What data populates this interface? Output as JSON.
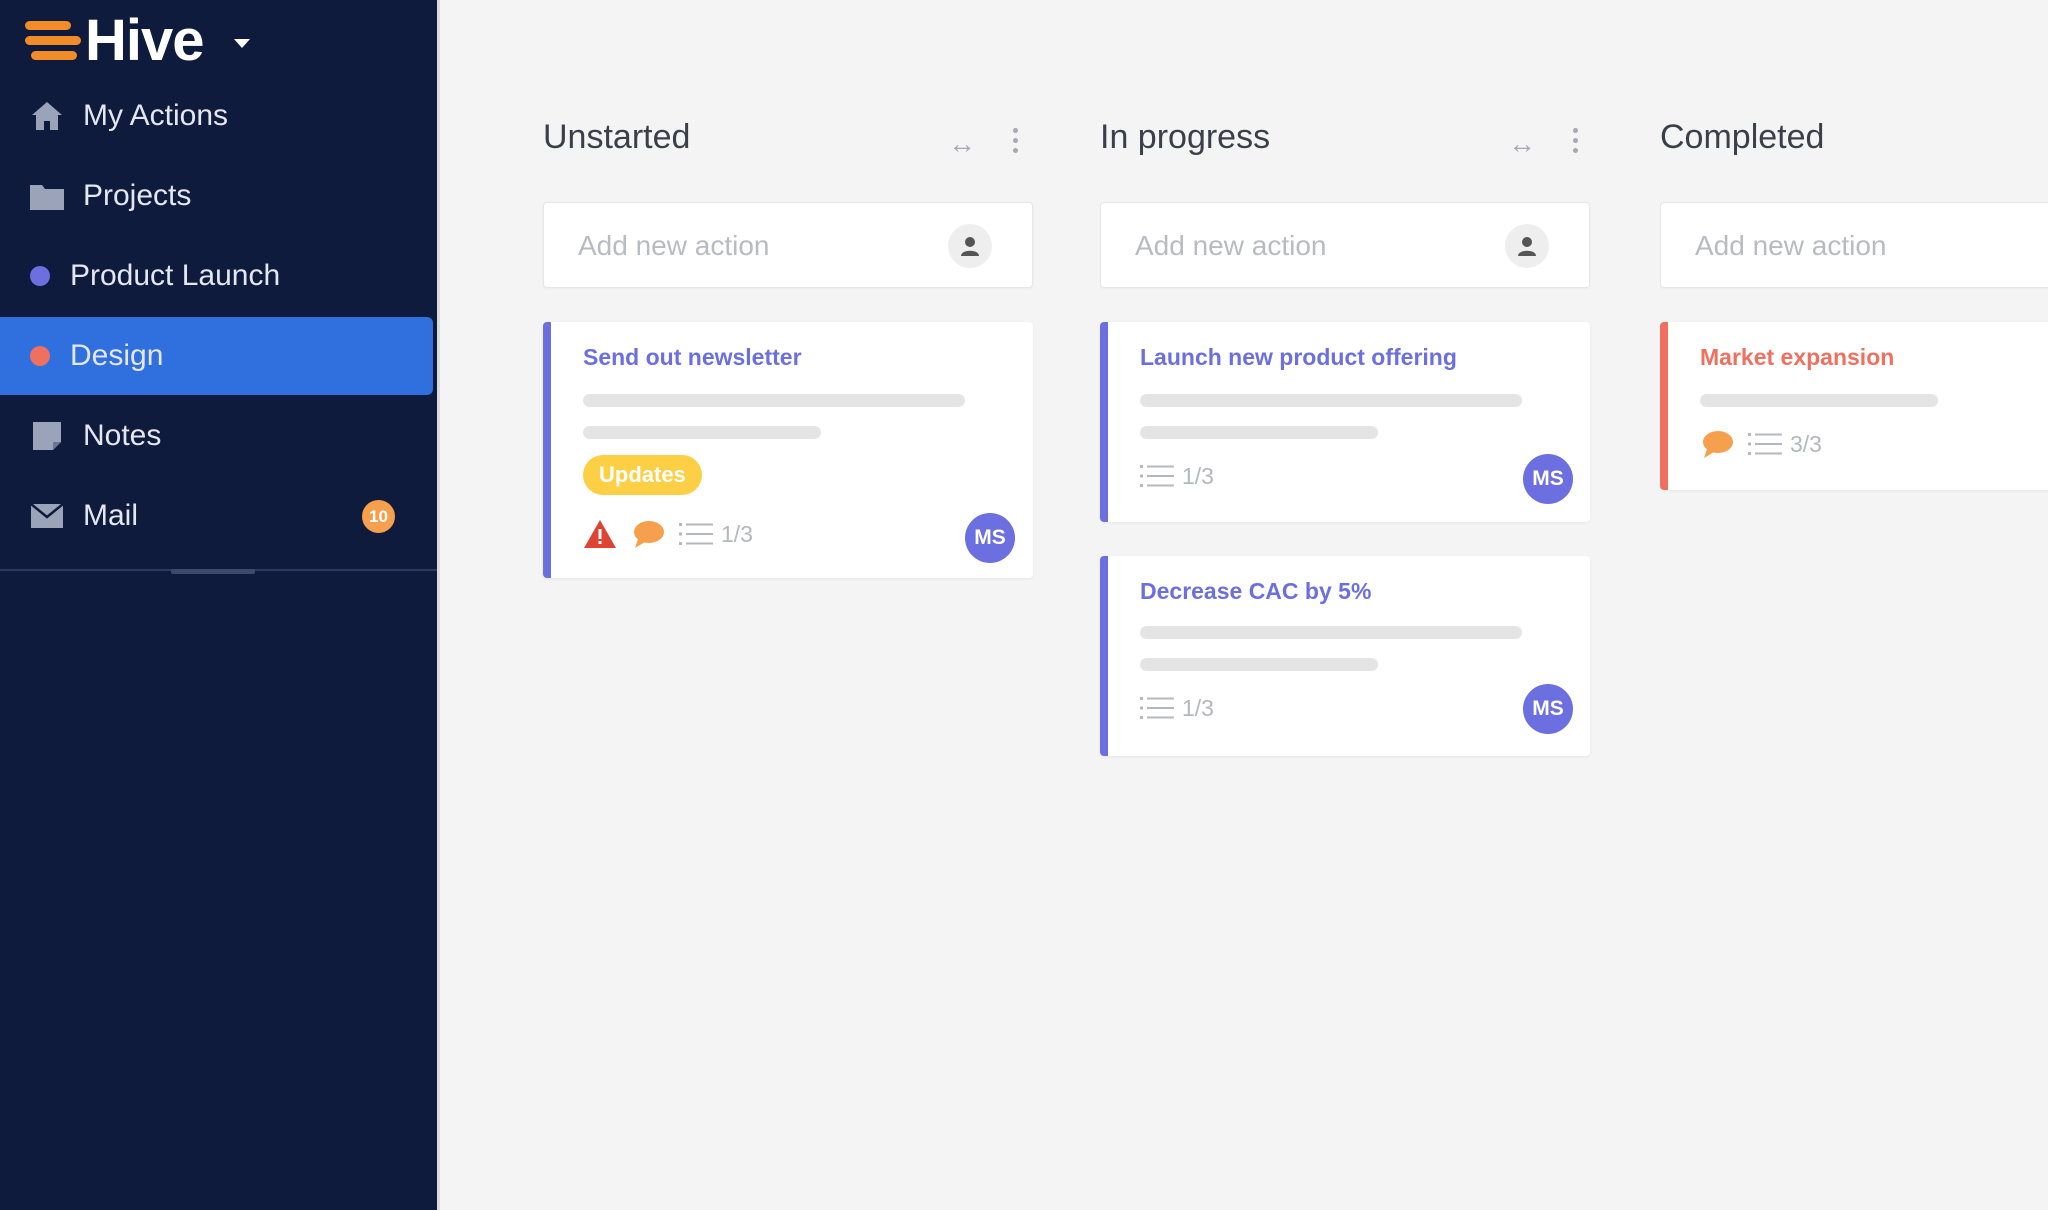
{
  "app": {
    "name": "Hive"
  },
  "sidebar": {
    "items": [
      {
        "label": "My Actions",
        "icon": "home-icon"
      },
      {
        "label": "Projects",
        "icon": "folder-icon"
      },
      {
        "label": "Product Launch",
        "icon": "project-dot-icon",
        "color": "#6c6fe0"
      },
      {
        "label": "Design",
        "icon": "project-dot-icon",
        "color": "#f07060",
        "active": true
      },
      {
        "label": "Notes",
        "icon": "note-icon"
      },
      {
        "label": "Mail",
        "icon": "mail-icon",
        "badge": "10"
      }
    ]
  },
  "board": {
    "columns": [
      {
        "title": "Unstarted",
        "add_placeholder": "Add new action",
        "cards": [
          {
            "title": "Send out newsletter",
            "tag": "Updates",
            "subtasks": "1/3",
            "assignee": "MS",
            "has_warning": true,
            "has_comment": true,
            "color": "#6c6fe0"
          }
        ]
      },
      {
        "title": "In progress",
        "add_placeholder": "Add new action",
        "cards": [
          {
            "title": "Launch new product offering",
            "subtasks": "1/3",
            "assignee": "MS",
            "color": "#6c6fe0"
          },
          {
            "title": "Decrease CAC by 5%",
            "subtasks": "1/3",
            "assignee": "MS",
            "color": "#6c6fe0"
          }
        ]
      },
      {
        "title": "Completed",
        "add_placeholder": "Add new action",
        "cards": [
          {
            "title": "Market expansion",
            "subtasks": "3/3",
            "has_comment": true,
            "color": "#f07060"
          }
        ]
      }
    ]
  },
  "colors": {
    "sidebar_bg": "#0f1b3d",
    "active_nav": "#2f6fde",
    "brand_orange": "#f28c28",
    "accent_purple": "#6c6fe0",
    "accent_red": "#f07060",
    "tag_yellow": "#fccf45"
  }
}
